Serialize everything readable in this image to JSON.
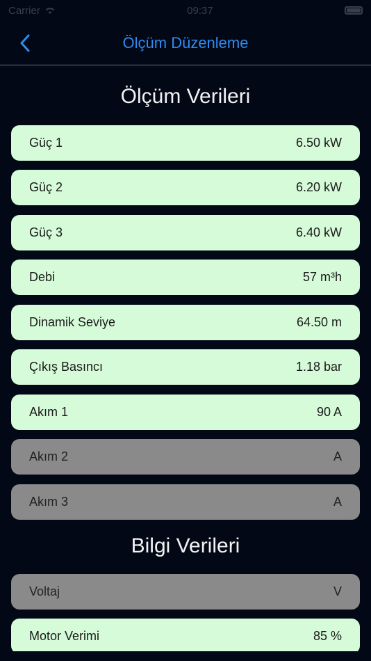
{
  "status_bar": {
    "carrier": "Carrier",
    "time": "09:37"
  },
  "nav": {
    "title": "Ölçüm Düzenleme"
  },
  "measurements": {
    "title": "Ölçüm Verileri",
    "items": [
      {
        "label": "Güç 1",
        "value": "6.50 kW",
        "active": true
      },
      {
        "label": "Güç 2",
        "value": "6.20 kW",
        "active": true
      },
      {
        "label": "Güç 3",
        "value": "6.40 kW",
        "active": true
      },
      {
        "label": "Debi",
        "value": "57 m³h",
        "active": true
      },
      {
        "label": "Dinamik Seviye",
        "value": "64.50 m",
        "active": true
      },
      {
        "label": "Çıkış Basıncı",
        "value": "1.18 bar",
        "active": true
      },
      {
        "label": "Akım 1",
        "value": "90 A",
        "active": true
      },
      {
        "label": "Akım 2",
        "value": "A",
        "active": false
      },
      {
        "label": "Akım 3",
        "value": "A",
        "active": false
      }
    ]
  },
  "info": {
    "title": "Bilgi Verileri",
    "items": [
      {
        "label": "Voltaj",
        "value": "V",
        "active": false
      },
      {
        "label": "Motor Verimi",
        "value": "85 %",
        "active": true
      }
    ]
  },
  "colors": {
    "background": "#020816",
    "accent": "#2f8bf0",
    "row_active": "#d6fbd9",
    "row_inactive": "#8a8a8a"
  }
}
